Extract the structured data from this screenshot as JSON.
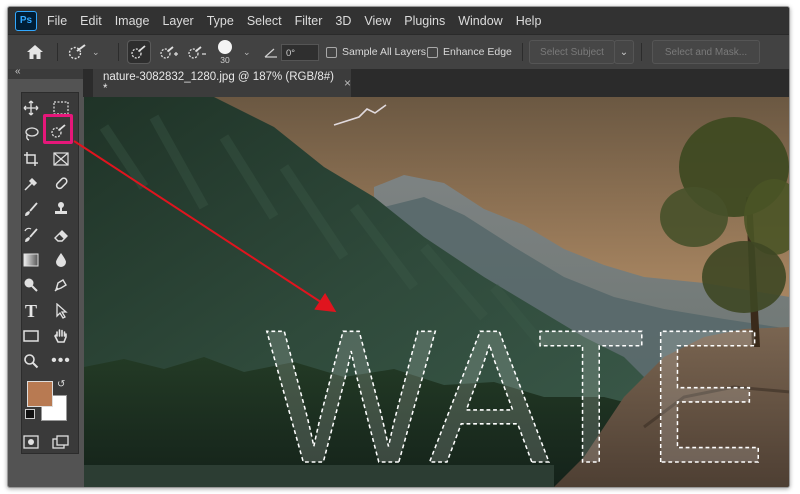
{
  "app": {
    "logo": "Ps"
  },
  "menu": [
    "File",
    "Edit",
    "Image",
    "Layer",
    "Type",
    "Select",
    "Filter",
    "3D",
    "View",
    "Plugins",
    "Window",
    "Help"
  ],
  "options": {
    "brush_size": "30",
    "angle": "0°",
    "sample_all_layers": "Sample All Layers",
    "enhance_edge": "Enhance Edge",
    "select_subject": "Select Subject",
    "select_and_mask": "Select and Mask..."
  },
  "document": {
    "tab_title": "nature-3082832_1280.jpg @ 187% (RGB/8#) *",
    "selection_text": "WATE"
  },
  "colors": {
    "foreground": "#b87a52",
    "background": "#ffffff",
    "highlight": "#e6177a",
    "arrow": "#e0141e"
  },
  "tools": [
    "move-tool",
    "marquee-tool",
    "lasso-tool",
    "quick-selection-tool",
    "crop-tool",
    "frame-tool",
    "eyedropper-tool",
    "healing-brush-tool",
    "brush-tool",
    "clone-stamp-tool",
    "history-brush-tool",
    "eraser-tool",
    "gradient-tool",
    "blur-tool",
    "dodge-tool",
    "pen-tool",
    "type-tool",
    "path-selection-tool",
    "rectangle-tool",
    "hand-tool",
    "zoom-tool",
    "more-tools"
  ]
}
